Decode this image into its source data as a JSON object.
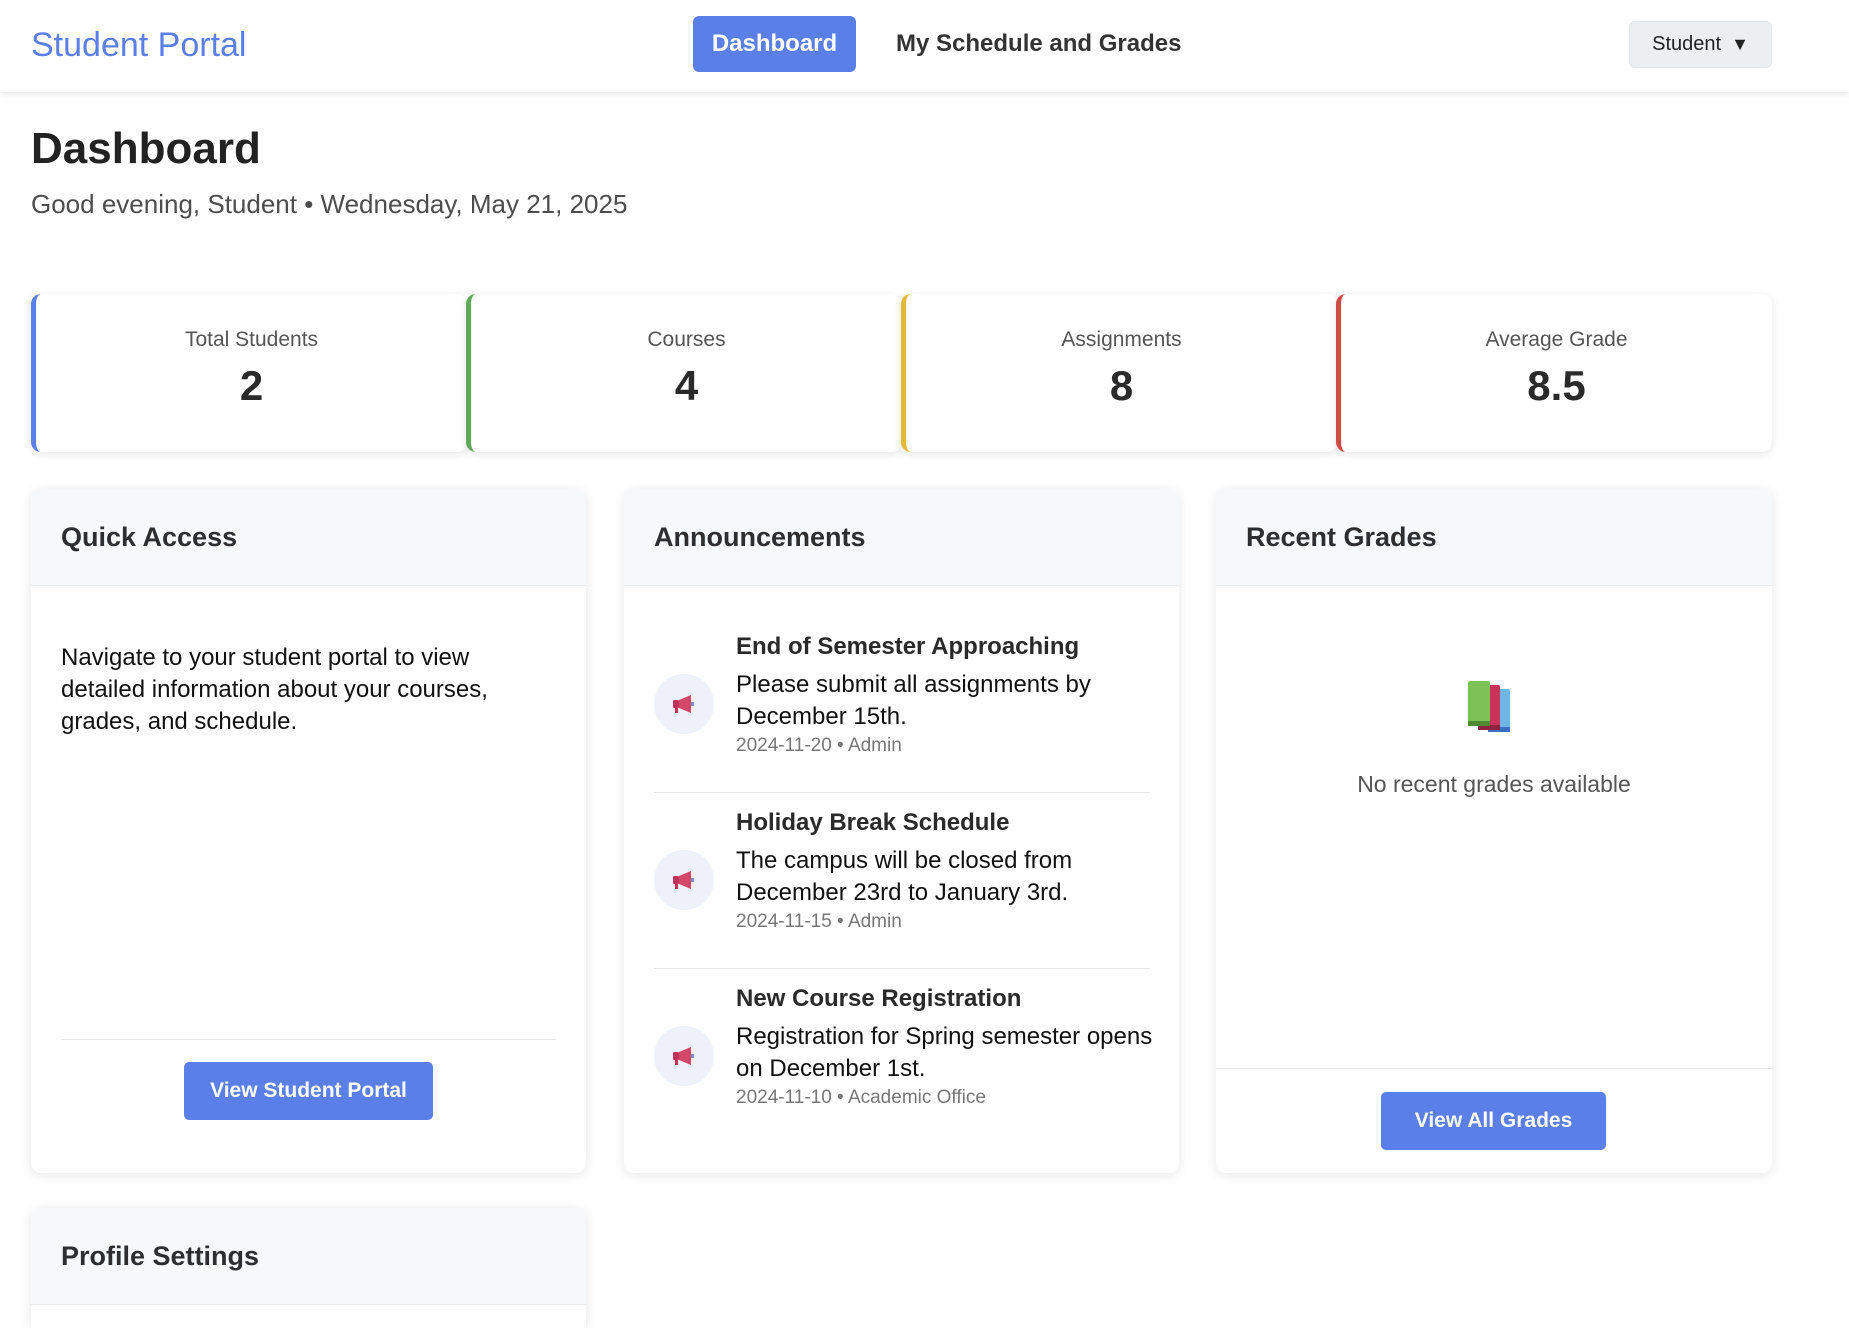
{
  "nav": {
    "brand": "Student Portal",
    "links": [
      "Dashboard",
      "My Schedule and Grades"
    ],
    "user_label": "Student",
    "user_caret": "▼"
  },
  "header": {
    "title": "Dashboard",
    "subtitle": "Good evening, Student • Wednesday, May 21, 2025"
  },
  "stats": [
    {
      "label": "Total Students",
      "value": "2",
      "accent": "#5b7fe8"
    },
    {
      "label": "Courses",
      "value": "4",
      "accent": "#5fa85a"
    },
    {
      "label": "Assignments",
      "value": "8",
      "accent": "#e3b93c"
    },
    {
      "label": "Average Grade",
      "value": "8.5",
      "accent": "#d24a43"
    }
  ],
  "quick_access": {
    "title": "Quick Access",
    "text": "Navigate to your student portal to view detailed information about your courses, grades, and schedule.",
    "button": "View Student Portal"
  },
  "announcements": {
    "title": "Announcements",
    "items": [
      {
        "title": "End of Semester Approaching",
        "body": "Please submit all assignments by December 15th.",
        "meta": "2024-11-20 • Admin",
        "icon": "megaphone-icon"
      },
      {
        "title": "Holiday Break Schedule",
        "body": "The campus will be closed from December 23rd to January 3rd.",
        "meta": "2024-11-15 • Admin",
        "icon": "megaphone-icon"
      },
      {
        "title": "New Course Registration",
        "body": "Registration for Spring semester opens on December 1st.",
        "meta": "2024-11-10 • Academic Office",
        "icon": "megaphone-icon"
      }
    ]
  },
  "recent_grades": {
    "title": "Recent Grades",
    "icon": "books-icon",
    "empty_text": "No recent grades available",
    "button": "View All Grades"
  },
  "profile": {
    "title": "Profile Settings"
  }
}
